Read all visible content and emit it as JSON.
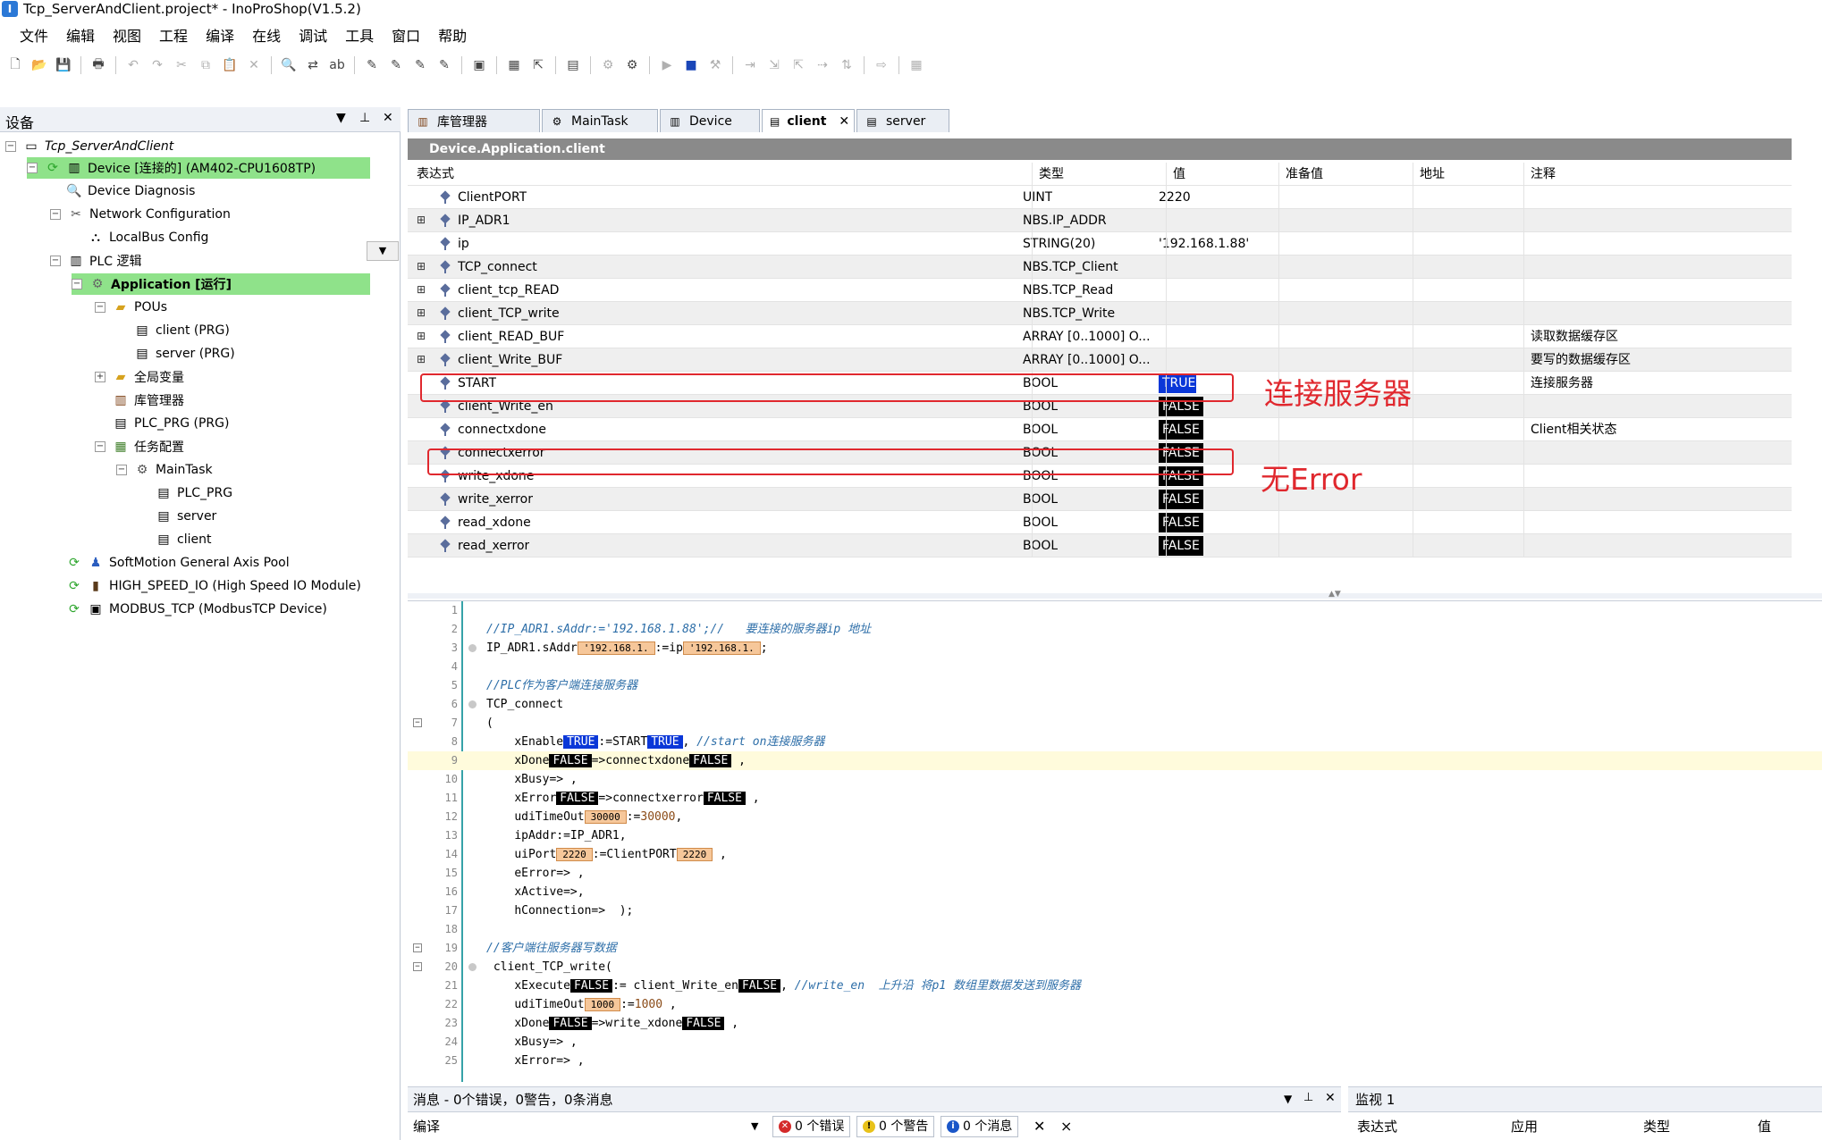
{
  "window": {
    "title": "Tcp_ServerAndClient.project* - InoProShop(V1.5.2)"
  },
  "menu": [
    "文件",
    "编辑",
    "视图",
    "工程",
    "编译",
    "在线",
    "调试",
    "工具",
    "窗口",
    "帮助"
  ],
  "device_panel": {
    "title": "设备",
    "tree": [
      {
        "label": "Tcp_ServerAndClient",
        "icon": "project-icon"
      },
      {
        "label": "Device [连接的] (AM402-CPU1608TP)",
        "icon": "device-icon"
      },
      {
        "label": "Device Diagnosis",
        "icon": "diagnosis-icon"
      },
      {
        "label": "Network Configuration",
        "icon": "network-icon"
      },
      {
        "label": "LocalBus Config",
        "icon": "localbus-icon"
      },
      {
        "label": "PLC 逻辑",
        "icon": "plc-logic-icon"
      },
      {
        "label": "Application [运行]",
        "icon": "application-icon"
      },
      {
        "label": "POUs",
        "icon": "folder-icon"
      },
      {
        "label": "client (PRG)",
        "icon": "program-icon"
      },
      {
        "label": "server (PRG)",
        "icon": "program-icon"
      },
      {
        "label": "全局变量",
        "icon": "folder-icon"
      },
      {
        "label": "库管理器",
        "icon": "library-icon"
      },
      {
        "label": "PLC_PRG (PRG)",
        "icon": "program-icon"
      },
      {
        "label": "任务配置",
        "icon": "task-config-icon"
      },
      {
        "label": "MainTask",
        "icon": "task-icon"
      },
      {
        "label": "PLC_PRG",
        "icon": "program-call-icon"
      },
      {
        "label": "server",
        "icon": "program-call-icon"
      },
      {
        "label": "client",
        "icon": "program-call-icon"
      },
      {
        "label": "SoftMotion General Axis Pool",
        "icon": "axis-pool-icon"
      },
      {
        "label": "HIGH_SPEED_IO (High Speed IO Module)",
        "icon": "io-module-icon"
      },
      {
        "label": "MODBUS_TCP (ModbusTCP Device)",
        "icon": "modbus-icon"
      }
    ]
  },
  "tabs": [
    {
      "label": "库管理器",
      "icon": "library-icon"
    },
    {
      "label": "MainTask",
      "icon": "task-icon"
    },
    {
      "label": "Device",
      "icon": "device-icon"
    },
    {
      "label": "client",
      "icon": "program-icon",
      "active": true
    },
    {
      "label": "server",
      "icon": "program-icon"
    }
  ],
  "watch": {
    "path": "Device.Application.client",
    "headers": [
      "表达式",
      "类型",
      "值",
      "准备值",
      "地址",
      "注释"
    ],
    "rows": [
      {
        "expr": "ClientPORT",
        "type": "UINT",
        "value": "2220",
        "comment": ""
      },
      {
        "expr": "IP_ADR1",
        "type": "NBS.IP_ADDR",
        "value": "",
        "comment": "",
        "expandable": true
      },
      {
        "expr": "ip",
        "type": "STRING(20)",
        "value": "'192.168.1.88'",
        "comment": ""
      },
      {
        "expr": "TCP_connect",
        "type": "NBS.TCP_Client",
        "value": "",
        "comment": "",
        "expandable": true
      },
      {
        "expr": "client_tcp_READ",
        "type": "NBS.TCP_Read",
        "value": "",
        "comment": "",
        "expandable": true
      },
      {
        "expr": "client_TCP_write",
        "type": "NBS.TCP_Write",
        "value": "",
        "comment": "",
        "expandable": true
      },
      {
        "expr": "client_READ_BUF",
        "type": "ARRAY [0..1000] O...",
        "value": "",
        "comment": "读取数据缓存区",
        "expandable": true
      },
      {
        "expr": "client_Write_BUF",
        "type": "ARRAY [0..1000] O...",
        "value": "",
        "comment": "要写的数据缓存区",
        "expandable": true
      },
      {
        "expr": "START",
        "type": "BOOL",
        "value": "TRUE",
        "comment": "连接服务器"
      },
      {
        "expr": "client_Write_en",
        "type": "BOOL",
        "value": "FALSE",
        "comment": ""
      },
      {
        "expr": "connectxdone",
        "type": "BOOL",
        "value": "FALSE",
        "comment": "Client相关状态"
      },
      {
        "expr": "connectxerror",
        "type": "BOOL",
        "value": "FALSE",
        "comment": ""
      },
      {
        "expr": "write_xdone",
        "type": "BOOL",
        "value": "FALSE",
        "comment": ""
      },
      {
        "expr": "write_xerror",
        "type": "BOOL",
        "value": "FALSE",
        "comment": ""
      },
      {
        "expr": "read_xdone",
        "type": "BOOL",
        "value": "FALSE",
        "comment": ""
      },
      {
        "expr": "read_xerror",
        "type": "BOOL",
        "value": "FALSE",
        "comment": ""
      }
    ]
  },
  "annotations": {
    "connect": "连接服务器",
    "no_error": "无Error"
  },
  "code": {
    "lines": [
      "",
      "//IP_ADR1.sAddr:='192.168.1.88';//   要连接的服务器ip 地址",
      "IP_ADR1.sAddr[ '192.168.1. ]:=ip[ '192.168.1. ];",
      "",
      "//PLC作为客户端连接服务器",
      "TCP_connect",
      "(",
      "    xEnable[TRUE]:=START[TRUE], //start on连接服务器",
      "    xDone[FALSE]=>connectxdone[FALSE] ,",
      "    xBusy=> ,",
      "    xError[FALSE]=>connectxerror[FALSE] ,",
      "    udiTimeOut[30000]:=30000,",
      "    ipAddr:=IP_ADR1,",
      "    uiPort[2220]:=ClientPORT[2220] ,",
      "    eError=> ,",
      "    xActive=>,",
      "    hConnection=>  );",
      "",
      "//客户端往服务器写数据",
      " client_TCP_write(",
      "    xExecute[FALSE]:= client_Write_en[FALSE], //write_en  上升沿 将p1 数组里数据发送到服务器",
      "    udiTimeOut[1000]:=1000 ,",
      "    xDone[FALSE]=>write_xdone[FALSE] ,",
      "    xBusy=> ,",
      "    xError=> ,"
    ],
    "tokens": {
      "comment1": "//IP_ADR1.sAddr:='192.168.1.88';//   要连接的服务器ip 地址",
      "ipaddr_prefix": "IP_ADR1.sAddr",
      "ipaddr_mon": "'192.168.1.",
      "ipaddr_mid": ":=ip",
      "ip_mon": "'192.168.1.",
      "comment2": "//PLC作为客户端连接服务器",
      "tcp_connect": "TCP_connect",
      "paren_open": "(",
      "xenable": "xEnable",
      "true": "TRUE",
      "false": "FALSE",
      "start_assign": ":=START",
      "comment3": "//start on连接服务器",
      "xdone": "xDone",
      "connectxdone": "=>connectxdone",
      "xbusy": "xBusy=> ,",
      "xerror": "xError",
      "connectxerror": "=>connectxerror",
      "udi": "udiTimeOut",
      "udi_mon": "30000",
      "udi_assign": ":=",
      "udi_val": "30000",
      "ipaddr_line": "ipAddr:=IP_ADR1,",
      "uiport": "uiPort",
      "port_mon": "2220",
      "port_assign": ":=ClientPORT",
      "eerror": "eError=> ,",
      "xactive": "xActive=>,",
      "hconn": "hConnection=>  );",
      "comment4": "//客户端往服务器写数据",
      "tcp_write": " client_TCP_write(",
      "xexecute": "xExecute",
      "write_en_assign": ":= client_Write_en",
      "comment5": "//write_en  上升沿 将p1 数组里数据发送到服务器",
      "udi2_mon": "1000",
      "udi2_val": "1000",
      "write_xdone": "=>write_xdone",
      "xerror2": "xError=> ,"
    }
  },
  "messages": {
    "title": "消息 - 0个错误，0警告，0条消息",
    "filter": "编译",
    "errors": "0 个错误",
    "warnings": "0 个警告",
    "infos": "0 个消息"
  },
  "watch_panel": {
    "title": "监视 1",
    "headers": [
      "表达式",
      "应用",
      "类型",
      "值"
    ]
  },
  "colors": {
    "online_true": "#0a37d8",
    "online_false": "#000000",
    "highlight_green": "#8fe28a",
    "annotation_red": "#e0282e",
    "comment_blue": "#2d6ea8"
  }
}
